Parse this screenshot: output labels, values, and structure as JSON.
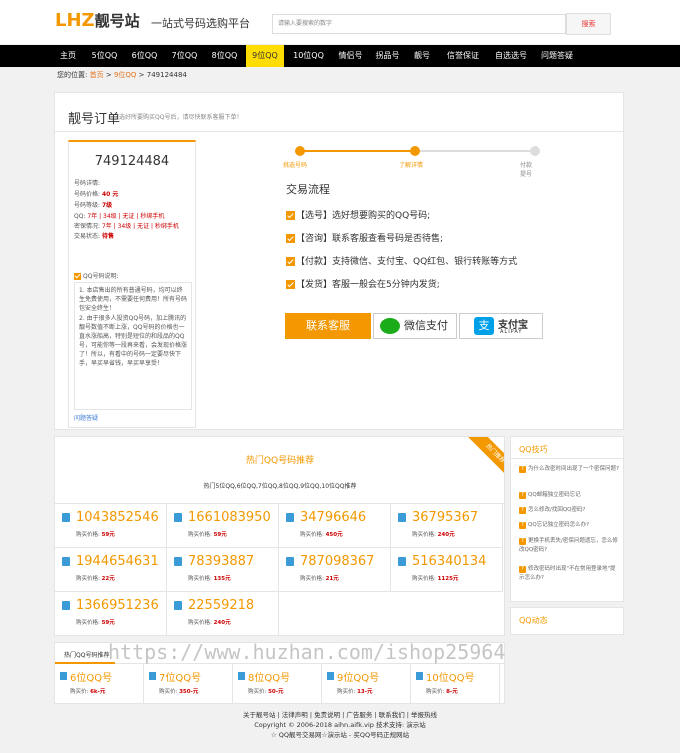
{
  "header": {
    "logo_latin": "LHZ",
    "logo_cn": "靓号站",
    "slogan": "一站式号码选购平台",
    "search_placeholder": "请输入要搜索的数字",
    "search_button": "搜索"
  },
  "nav": {
    "items": [
      "主页",
      "5位QQ",
      "6位QQ",
      "7位QQ",
      "8位QQ",
      "9位QQ",
      "10位QQ",
      "情侣号",
      "拐品号",
      "靓号",
      "信誉保证",
      "自选选号",
      "问题答疑"
    ],
    "active_index": 5
  },
  "breadcrumb": {
    "prefix": "您的位置:",
    "home": "首页",
    "sep1": ">",
    "category": "9位QQ",
    "sep2": ">",
    "current": "749124484"
  },
  "order": {
    "title": "靓号订单",
    "subtitle": "选好所要购买QQ号后，请尽快联系客服下单！",
    "number": "749124484",
    "info_heading": "号码详情:",
    "price_label": "号码价格:",
    "price_value": "40 元",
    "grade_label": "号码等级:",
    "grade_value": "7级",
    "qq_label": "QQ:",
    "qq_value": "7年 | 34级 | 无证 | 秒绑手机",
    "secret_label": "密保情况:",
    "secret_value": "7年 | 34级 | 无证 | 秒绑手机",
    "status_label": "交易状态:",
    "status_value": "待售",
    "note_check": "QQ号码说明:",
    "note_1": "1. 本店售出的所有普通号码，均可以终生免费使用，不需要任何费用！所有号码包安全终生！",
    "note_2": "2. 由于很多人投资QQ号码，加上腾讯的靓号数值不断上涨，QQ号码的价格也一直水涨船高，特别是短位的和段品的QQ号，可能你等一段再来看，会发现价格涨了！所以，有看中的号码一定要尽快下手，早买早省钱，早买早享受！",
    "faq_link": "问题答疑"
  },
  "progress": {
    "steps": [
      "挑选号码",
      "了解详情",
      "付款提号"
    ],
    "active_color": "#f39800"
  },
  "flow": {
    "title": "交易流程",
    "items": [
      "【选号】选好想要购买的QQ号码;",
      "【咨询】联系客服查看号码是否待售;",
      "【付款】支持微信、支付宝、QQ红包、银行转账等方式",
      "【发货】客服一般会在5分钟内发货;"
    ]
  },
  "payment": {
    "service_btn": "联系客服",
    "wechat_btn": "微信支付",
    "alipay_cn": "支付宝",
    "alipay_en": "ALIPAY"
  },
  "hot": {
    "title": "热门QQ号码推荐",
    "subtitle": "热门5位QQ,6位QQ,7位QQ,8位QQ,9位QQ,10位QQ推荐",
    "ribbon": "热门推荐",
    "price_label": "购买价格:",
    "items": [
      {
        "num": "1043852546",
        "price": "59元"
      },
      {
        "num": "1661083950",
        "price": "59元"
      },
      {
        "num": "34796646",
        "price": "450元"
      },
      {
        "num": "36795367",
        "price": "240元"
      },
      {
        "num": "1944654631",
        "price": "22元"
      },
      {
        "num": "78393887",
        "price": "135元"
      },
      {
        "num": "787098367",
        "price": "21元"
      },
      {
        "num": "516340134",
        "price": "1125元"
      },
      {
        "num": "1366951236",
        "price": "59元"
      },
      {
        "num": "22559218",
        "price": "240元"
      }
    ]
  },
  "sidebar": {
    "tips_title": "QQ技巧",
    "tips": [
      "为什么改密时间出现了一个密保问题?",
      "QQ邮箱独立密码忘记",
      "怎么修改/找回QQ密码?",
      "QQ忘记独立密码怎么办?",
      "更换手机丢失/密保问题遗忘，怎么修改QQ密码?",
      "修改密码时出现\"不在常用登录地\"提示怎么办?"
    ],
    "news_title": "QQ动态"
  },
  "categories": {
    "title": "热门QQ号码推荐",
    "price_label": "购买价:",
    "items": [
      {
        "name": "6位QQ号",
        "price": "6k-元"
      },
      {
        "name": "7位QQ号",
        "price": "350-元"
      },
      {
        "name": "8位QQ号",
        "price": "50-元"
      },
      {
        "name": "9位QQ号",
        "price": "13-元"
      },
      {
        "name": "10位QQ号",
        "price": "8-元"
      }
    ]
  },
  "watermark": "https://www.huzhan.com/ishop25964",
  "footer": {
    "links": "关于靓号站 | 法律声明 | 免责说明 | 广告服务 | 联系我们 | 举报热线",
    "copyright": "Copyright © 2006-2018 aihn.aifk.vip 技术支持: 演示站",
    "tagline": "☆ QQ靓号交易网☆演示站 - 买QQ号码正规网站"
  }
}
